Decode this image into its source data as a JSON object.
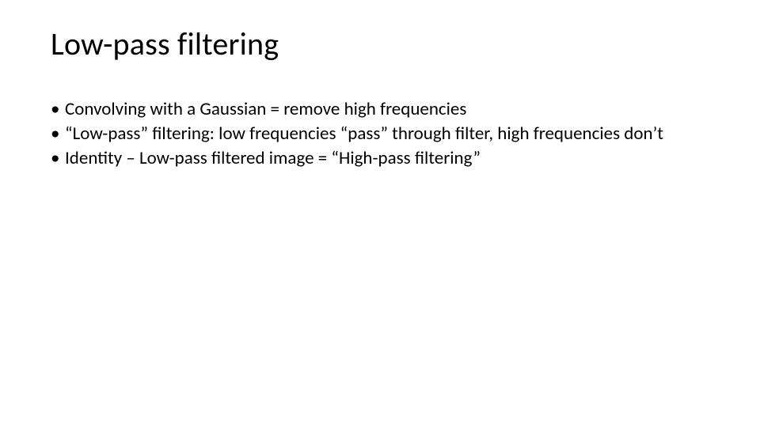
{
  "slide": {
    "title": "Low-pass filtering",
    "bullets": [
      "Convolving with a Gaussian = remove high frequencies",
      "“Low-pass” filtering: low frequencies “pass” through filter, high frequencies don’t",
      "Identity – Low-pass filtered image  = “High-pass filtering”"
    ]
  }
}
